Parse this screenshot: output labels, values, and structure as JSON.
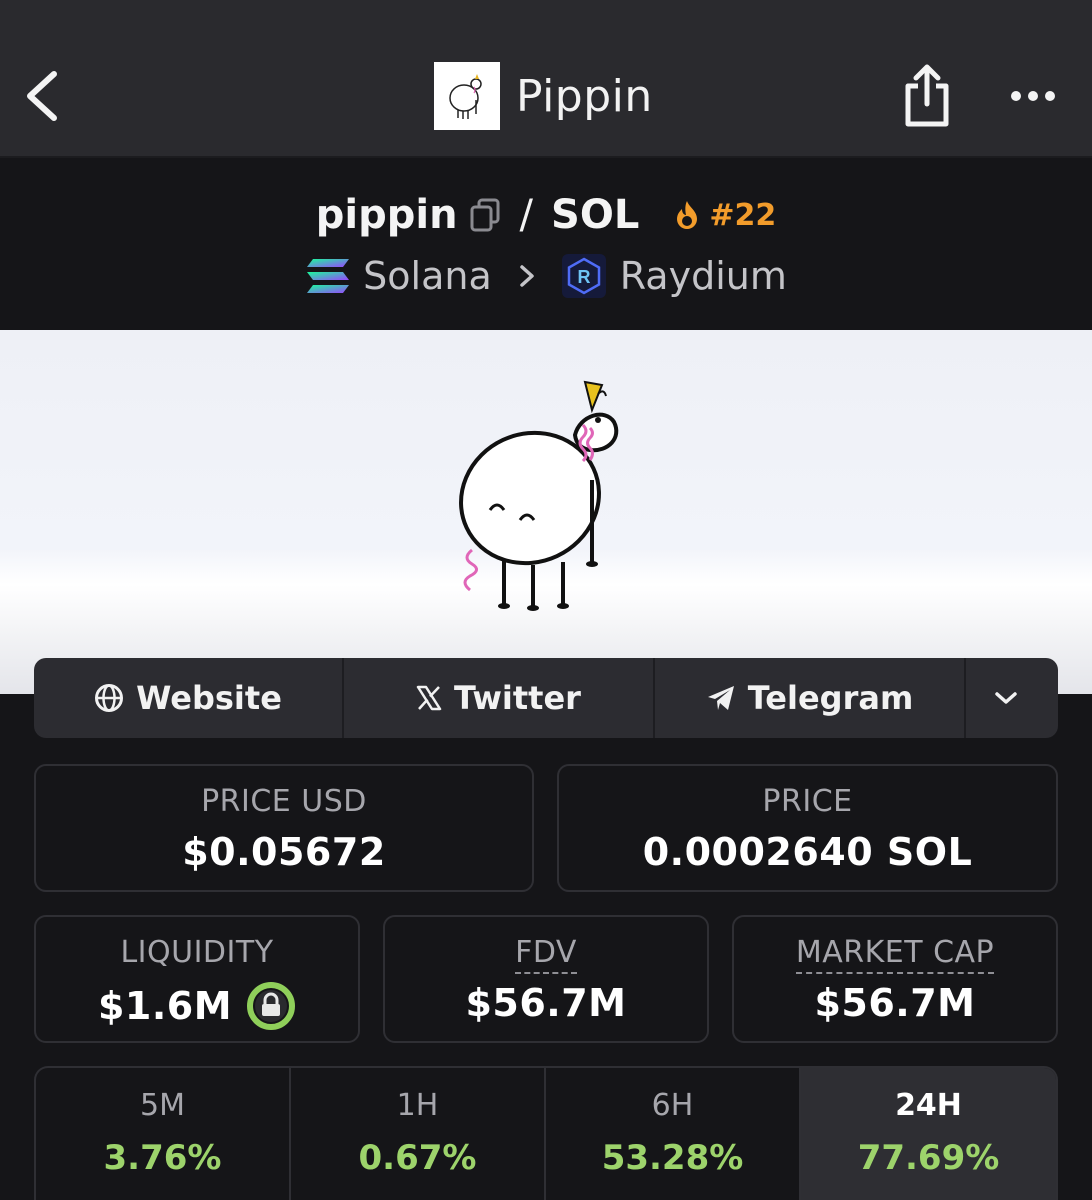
{
  "header": {
    "title": "Pippin",
    "back_icon": "chevron-left-icon",
    "share_icon": "share-icon",
    "more_icon": "more-horizontal-icon"
  },
  "pair": {
    "base": "pippin",
    "separator": "/",
    "quote": "SOL",
    "rank": "#22",
    "chain": "Solana",
    "dex": "Raydium"
  },
  "links": {
    "website": "Website",
    "twitter": "Twitter",
    "telegram": "Telegram"
  },
  "stats": {
    "price_usd_label": "PRICE USD",
    "price_usd_value": "$0.05672",
    "price_label": "PRICE",
    "price_value": "0.0002640 SOL",
    "liquidity_label": "LIQUIDITY",
    "liquidity_value": "$1.6M",
    "fdv_label": "FDV",
    "fdv_value": "$56.7M",
    "mcap_label": "MARKET CAP",
    "mcap_value": "$56.7M"
  },
  "timeframes": [
    {
      "label": "5M",
      "change": "3.76%"
    },
    {
      "label": "1H",
      "change": "0.67%"
    },
    {
      "label": "6H",
      "change": "53.28%"
    },
    {
      "label": "24H",
      "change": "77.69%"
    }
  ],
  "colors": {
    "positive": "#9dd36b",
    "rank": "#f29c2b",
    "lock": "#8fcf5a"
  }
}
